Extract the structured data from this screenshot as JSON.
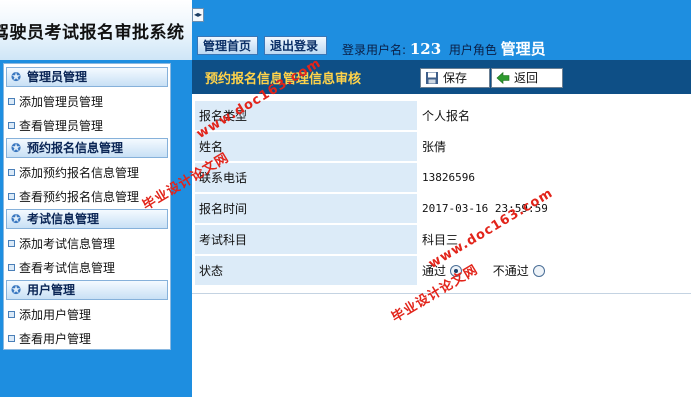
{
  "header": {
    "system_title": "驾驶员考试报名审批系统",
    "collapse_icon": "◂▸",
    "buttons": {
      "home": "管理首页",
      "logout": "退出登录"
    },
    "login_user_label": "登录用户名:",
    "login_user_value": "123",
    "role_label": "用户角色",
    "role_value": "管理员"
  },
  "sidebar": {
    "groups": [
      {
        "title": "管理员管理",
        "items": [
          "添加管理员管理",
          "查看管理员管理"
        ]
      },
      {
        "title": "预约报名信息管理",
        "items": [
          "添加预约报名信息管理",
          "查看预约报名信息管理"
        ]
      },
      {
        "title": "考试信息管理",
        "items": [
          "添加考试信息管理",
          "查看考试信息管理"
        ]
      },
      {
        "title": "用户管理",
        "items": [
          "添加用户管理",
          "查看用户管理"
        ]
      }
    ]
  },
  "main": {
    "title": "预约报名信息管理信息审核",
    "save_label": "保存",
    "back_label": "返回",
    "rows": [
      {
        "label": "报名类型",
        "value": "个人报名"
      },
      {
        "label": "姓名",
        "value": "张倩"
      },
      {
        "label": "联系电话",
        "value": "13826596"
      },
      {
        "label": "报名时间",
        "value": "2017-03-16 23:59:59"
      },
      {
        "label": "考试科目",
        "value": "科目三"
      },
      {
        "label": "状态",
        "option_pass": "通过",
        "option_fail": "不通过",
        "selected": "通过"
      }
    ]
  },
  "watermarks": [
    "www.doc163.com",
    "毕业设计论文网",
    "www.doc163.com",
    "毕业设计论文网"
  ],
  "colors": {
    "header_blue": "#1e8ee0",
    "content_head": "#0e4f86",
    "title_yellow": "#ffd34a",
    "label_bg": "#dcebf8",
    "watermark_red": "#e2241a"
  }
}
